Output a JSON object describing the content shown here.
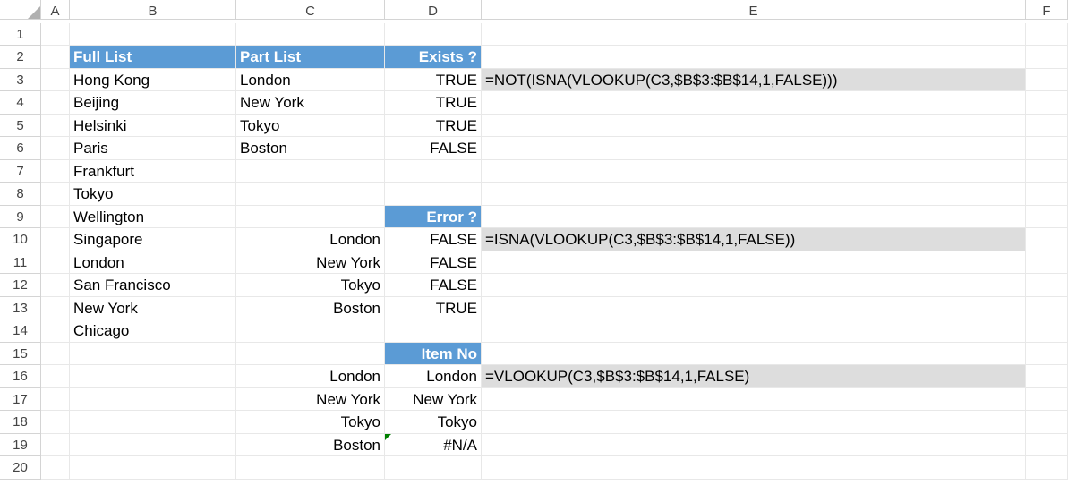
{
  "columns": [
    "A",
    "B",
    "C",
    "D",
    "E",
    "F"
  ],
  "rows": [
    "1",
    "2",
    "3",
    "4",
    "5",
    "6",
    "7",
    "8",
    "9",
    "10",
    "11",
    "12",
    "13",
    "14",
    "15",
    "16",
    "17",
    "18",
    "19",
    "20"
  ],
  "headers": {
    "fullList": "Full List",
    "partList": "Part List",
    "exists": "Exists ?",
    "error": "Error ?",
    "itemNo": "Item No"
  },
  "fullList": [
    "Hong Kong",
    "Beijing",
    "Helsinki",
    "Paris",
    "Frankfurt",
    "Tokyo",
    "Wellington",
    "Singapore",
    "London",
    "San Francisco",
    "New York",
    "Chicago"
  ],
  "partList1": [
    "London",
    "New York",
    "Tokyo",
    "Boston"
  ],
  "partList2": [
    "London",
    "New York",
    "Tokyo",
    "Boston"
  ],
  "partList3": [
    "London",
    "New York",
    "Tokyo",
    "Boston"
  ],
  "existsResults": [
    "TRUE",
    "TRUE",
    "TRUE",
    "FALSE"
  ],
  "errorResults": [
    "FALSE",
    "FALSE",
    "FALSE",
    "TRUE"
  ],
  "itemNoResults": [
    "London",
    "New York",
    "Tokyo",
    "#N/A"
  ],
  "formulas": {
    "exists": "=NOT(ISNA(VLOOKUP(C3,$B$3:$B$14,1,FALSE)))",
    "error": "=ISNA(VLOOKUP(C3,$B$3:$B$14,1,FALSE))",
    "itemNo": "=VLOOKUP(C3,$B$3:$B$14,1,FALSE)"
  },
  "chart_data": {
    "type": "table",
    "title": "VLOOKUP existence check examples",
    "tables": [
      {
        "name": "Full List",
        "values": [
          "Hong Kong",
          "Beijing",
          "Helsinki",
          "Paris",
          "Frankfurt",
          "Tokyo",
          "Wellington",
          "Singapore",
          "London",
          "San Francisco",
          "New York",
          "Chicago"
        ]
      },
      {
        "name": "Exists ?",
        "lookup": [
          "London",
          "New York",
          "Tokyo",
          "Boston"
        ],
        "result": [
          "TRUE",
          "TRUE",
          "TRUE",
          "FALSE"
        ],
        "formula": "=NOT(ISNA(VLOOKUP(C3,$B$3:$B$14,1,FALSE)))"
      },
      {
        "name": "Error ?",
        "lookup": [
          "London",
          "New York",
          "Tokyo",
          "Boston"
        ],
        "result": [
          "FALSE",
          "FALSE",
          "FALSE",
          "TRUE"
        ],
        "formula": "=ISNA(VLOOKUP(C3,$B$3:$B$14,1,FALSE))"
      },
      {
        "name": "Item No",
        "lookup": [
          "London",
          "New York",
          "Tokyo",
          "Boston"
        ],
        "result": [
          "London",
          "New York",
          "Tokyo",
          "#N/A"
        ],
        "formula": "=VLOOKUP(C3,$B$3:$B$14,1,FALSE)"
      }
    ]
  }
}
